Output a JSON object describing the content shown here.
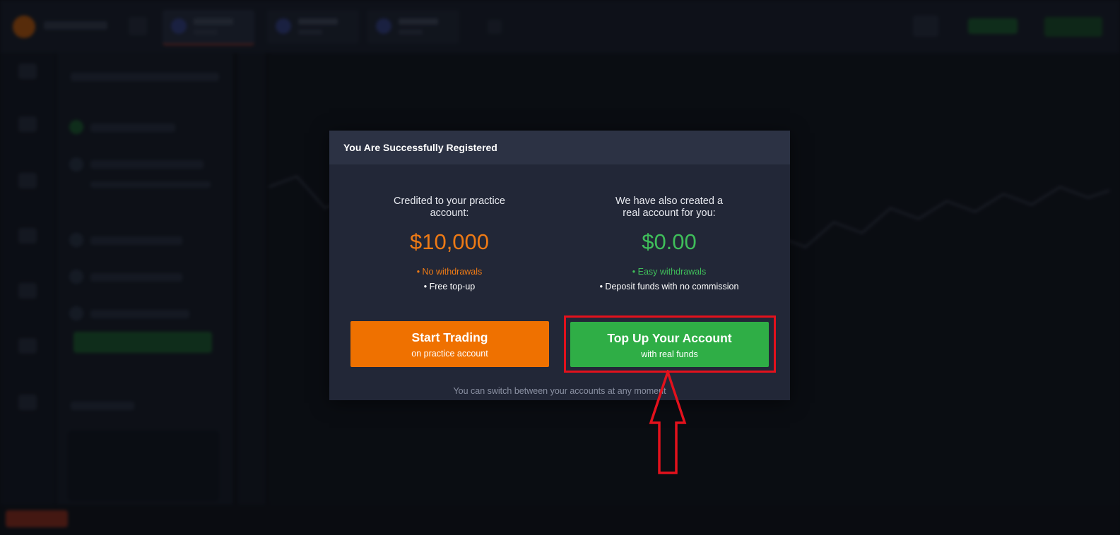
{
  "modal": {
    "title": "You Are Successfully Registered",
    "practice": {
      "heading": "Credited to your practice account:",
      "amount": "$10,000",
      "feature_1": "• No withdrawals",
      "feature_2": "• Free top-up",
      "button_main": "Start Trading",
      "button_sub": "on practice account",
      "accent_color": "#ef7100"
    },
    "real": {
      "heading": "We have also created a real account for you:",
      "amount": "$0.00",
      "feature_1": "• Easy withdrawals",
      "feature_2": "• Deposit funds with no commission",
      "button_main": "Top Up Your Account",
      "button_sub": "with real funds",
      "accent_color": "#2fae46"
    },
    "footnote": "You can switch between your accounts at any moment"
  },
  "annotation": {
    "highlight_color": "#e3111c",
    "arrow_icon": "up-arrow-icon"
  }
}
